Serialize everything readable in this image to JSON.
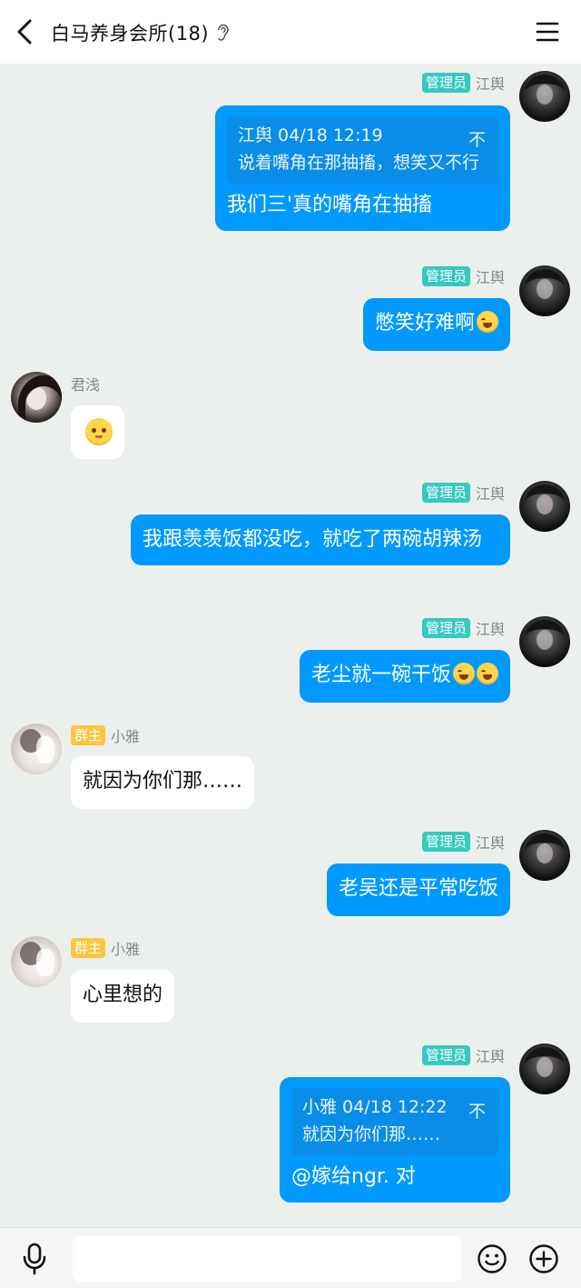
{
  "header": {
    "title": "白马养身会所(18)"
  },
  "messages": [
    {
      "badge": "管理员",
      "nick": "江舆",
      "quote": {
        "head": "江舆 04/18 12:19",
        "text": "说着嘴角在那抽搐，想笑又不行",
        "close": "不"
      },
      "text": "我们三'真的嘴角在抽搐"
    },
    {
      "badge": "管理员",
      "nick": "江舆",
      "text": "憋笑好难啊"
    },
    {
      "nick": "君浅",
      "text": ""
    },
    {
      "badge": "管理员",
      "nick": "江舆",
      "text": "我跟羡羡饭都没吃，就吃了两碗胡辣汤"
    },
    {
      "badge": "管理员",
      "nick": "江舆",
      "text": "老尘就一碗干饭"
    },
    {
      "badge": "群主",
      "nick": "小雅",
      "text": "就因为你们那……"
    },
    {
      "badge": "管理员",
      "nick": "江舆",
      "text": "老吴还是平常吃饭"
    },
    {
      "badge": "群主",
      "nick": "小雅",
      "text": "心里想的"
    },
    {
      "badge": "管理员",
      "nick": "江舆",
      "quote": {
        "head": "小雅 04/18 12:22",
        "text": "就因为你们那……",
        "close": "不"
      },
      "text": "@嫁给ngr. 对"
    }
  ],
  "input": {
    "placeholder": ""
  },
  "colors": {
    "outgoing": "#0099ff",
    "admin_badge": "#35c9c0",
    "owner_badge": "#ffc53d",
    "background": "#ecf0ed"
  },
  "icons": [
    "back-icon",
    "ear-icon",
    "menu-icon",
    "mic-icon",
    "smile-icon",
    "plus-icon"
  ]
}
